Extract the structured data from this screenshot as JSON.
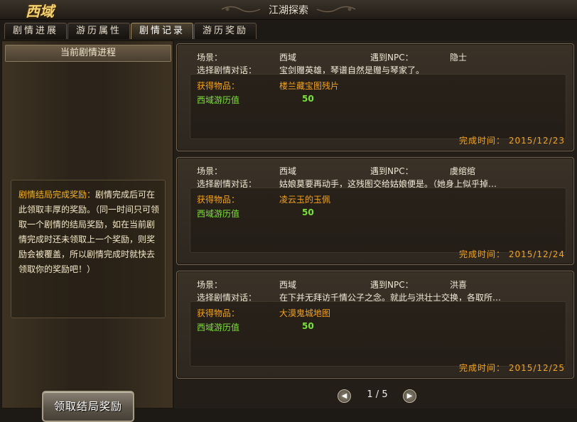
{
  "window": {
    "title": "江湖探索",
    "region_logo": "西域"
  },
  "tabs": [
    {
      "label": "剧情进展",
      "active": false
    },
    {
      "label": "游历属性",
      "active": false
    },
    {
      "label": "剧情记录",
      "active": true
    },
    {
      "label": "游历奖励",
      "active": false
    }
  ],
  "left_panel": {
    "header": "当前剧情进程",
    "rules_title": "剧情结局完成奖励：",
    "rules_text": "剧情完成后可在此领取丰厚的奖励。（同一时间只可领取一个剧情的结局奖励，如在当前剧情完成时还未领取上一个奖励，则奖励会被覆盖，所以剧情完成时就快去领取你的奖励吧！）",
    "claim_button": "领取结局奖励"
  },
  "labels": {
    "scene": "场景：",
    "meet_npc": "遇到NPC：",
    "dialogue": "选择剧情对话：",
    "item": "获得物品：",
    "exp": "西域游历值",
    "done": "完成时间："
  },
  "records": [
    {
      "scene": "西域",
      "npc": "隐士",
      "dialogue": "宝剑赠英雄，琴谱自然是赠与琴家了。",
      "item": "楼兰藏宝图残片",
      "exp": "50",
      "date": "2015/12/23"
    },
    {
      "scene": "西域",
      "npc": "虞绾绾",
      "dialogue": "姑娘莫要再动手，这残图交给姑娘便是。（她身上似乎掉…",
      "item": "凌云玉的玉佩",
      "exp": "50",
      "date": "2015/12/24"
    },
    {
      "scene": "西域",
      "npc": "洪喜",
      "dialogue": "在下并无拜访千情公子之念。就此与洪壮士交换，各取所…",
      "item": "大漠鬼城地图",
      "exp": "50",
      "date": "2015/12/25"
    }
  ],
  "pager": {
    "text": "1 / 5"
  },
  "colors": {
    "gold": "#f5a21e",
    "green": "#7ce23a",
    "title_gold": "#f3d470"
  }
}
